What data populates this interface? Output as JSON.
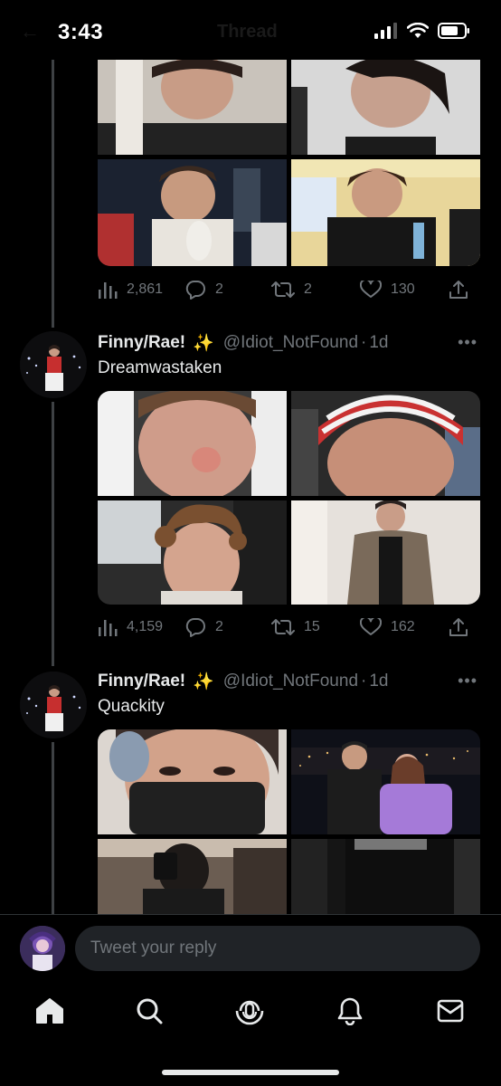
{
  "status_bar": {
    "time": "3:43",
    "faded_title": "Thread"
  },
  "tweets": [
    {
      "display_name": "",
      "handle": "",
      "time": "",
      "text": "",
      "stats": {
        "views": "2,861",
        "replies": "2",
        "retweets": "2",
        "likes": "130"
      }
    },
    {
      "display_name": "Finny/Rae!",
      "sparkle": "✨",
      "handle": "@Idiot_NotFound",
      "separator": "·",
      "time": "1d",
      "more": "•••",
      "text": "Dreamwastaken",
      "stats": {
        "views": "4,159",
        "replies": "2",
        "retweets": "15",
        "likes": "162"
      }
    },
    {
      "display_name": "Finny/Rae!",
      "sparkle": "✨",
      "handle": "@Idiot_NotFound",
      "separator": "·",
      "time": "1d",
      "more": "•••",
      "text": "Quackity"
    }
  ],
  "reply": {
    "placeholder": "Tweet your reply"
  },
  "tabs": [
    {
      "icon": "home-icon"
    },
    {
      "icon": "search-icon"
    },
    {
      "icon": "spaces-icon"
    },
    {
      "icon": "notifications-icon"
    },
    {
      "icon": "messages-icon"
    }
  ],
  "colors": {
    "background": "#000000",
    "text": "#e7e9ea",
    "muted": "#71767b",
    "sparkle": "#f5c518",
    "thread_line": "#3e4144"
  }
}
